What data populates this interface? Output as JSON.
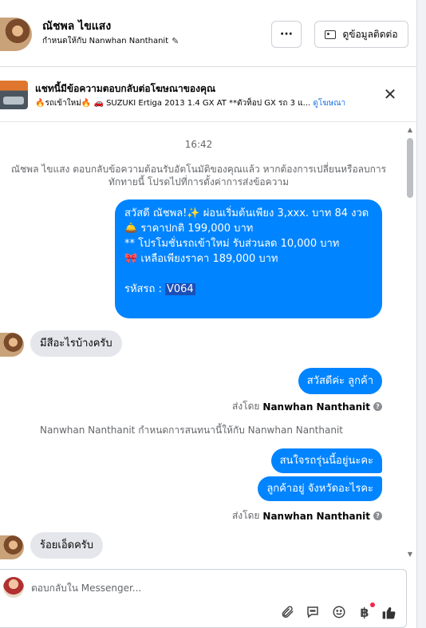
{
  "header": {
    "name": "ณัชพล ไขแสง",
    "assigned": "กำหนดให้กับ Nanwhan Nanthanit",
    "more_label": "···",
    "contact_label": "ดูข้อมูลติดต่อ"
  },
  "ad": {
    "title": "แชทนี้มีข้อความตอบกลับต่อโฆษณาของคุณ",
    "desc": "🔥รถเข้าใหม่🔥 🚗 SUZUKI Ertiga 2013 1.4 GX AT **ตัวท็อป GX รถ 3 แ...",
    "link": "ดูโฆษณา",
    "close_label": "✕"
  },
  "thread": {
    "time": "16:42",
    "system_message": "ณัชพล ไขแสง ตอบกลับข้อความต้อนรับอัตโนมัติของคุณแล้ว หากต้องการเปลี่ยนหรือลบการทักทายนี้ โปรดไปที่การตั้งค่าการส่งข้อความ",
    "big_message_lines": [
      "สวัสดี ณัชพล!✨  ผ่อนเริ่มต้นเพียง 3,xxx. บาท 84 งวด",
      "🛎️ ราคาปกติ 199,000 บาท",
      "** โปรโมชั่นรถเข้าใหม่ รับส่วนลด 10,000 บาท",
      "🎀  เหลือเพียงราคา 189,000 บาท",
      "",
      " รหัสรถ : "
    ],
    "big_message_code": "V064",
    "incoming_1": "มีสีอะไรบ้างครับ",
    "outgoing_1": "สวัสดีค่ะ ลูกค้า",
    "sent_by_prefix": "ส่งโดย",
    "sent_by_name": "Nanwhan Nanthanit",
    "assigned_notice": "Nanwhan Nanthanit กำหนดการสนทนานี้ให้กับ Nanwhan Nanthanit",
    "outgoing_2": "สนใจรถรุ่นนี้อยู่นะคะ",
    "outgoing_3": "ลูกค้าอยู่ จังหวัดอะไรคะ",
    "incoming_2": "ร้อยเอ็ดครับ"
  },
  "composer": {
    "placeholder": "ตอบกลับใน Messenger..."
  },
  "colors": {
    "accent": "#0084ff",
    "link": "#1b74e4",
    "notification_dot": "#f02849"
  },
  "icons": [
    "pencil-icon",
    "contact-card-icon",
    "close-icon",
    "attach-icon",
    "chat-icon",
    "emoji-icon",
    "baht-icon",
    "like-icon"
  ]
}
